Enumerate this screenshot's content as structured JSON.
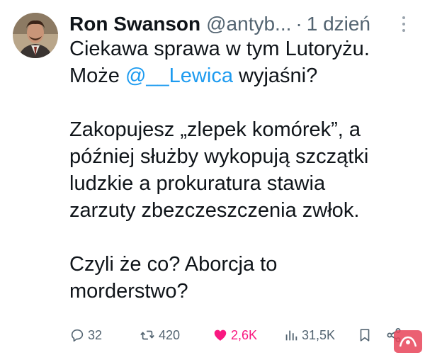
{
  "author": {
    "display_name": "Ron Swanson",
    "handle": "@antyb...",
    "separator": "·",
    "time": "1 dzień"
  },
  "tweet": {
    "line1": "Ciekawa sprawa w tym Lutoryżu.",
    "line2_prefix": "Może ",
    "line2_mention": "@__Lewica",
    "line2_suffix": " wyjaśni?",
    "para2": [
      "Zakopujesz „zlepek komórek”, a",
      "później służby wykopują szczątki",
      "ludzkie a prokuratura stawia",
      "zarzuty zbezczeszczenia zwłok."
    ],
    "para3": [
      "Czyli że co? Aborcja to",
      "morderstwo?"
    ]
  },
  "actions": {
    "replies": "32",
    "reposts": "420",
    "likes": "2,6K",
    "views": "31,5K"
  },
  "colors": {
    "accent": "#1d9bf0",
    "like": "#f91880",
    "secondary": "#536471"
  },
  "icons": [
    "more-icon",
    "reply-icon",
    "repost-icon",
    "like-icon",
    "views-icon",
    "bookmark-icon",
    "share-icon"
  ]
}
